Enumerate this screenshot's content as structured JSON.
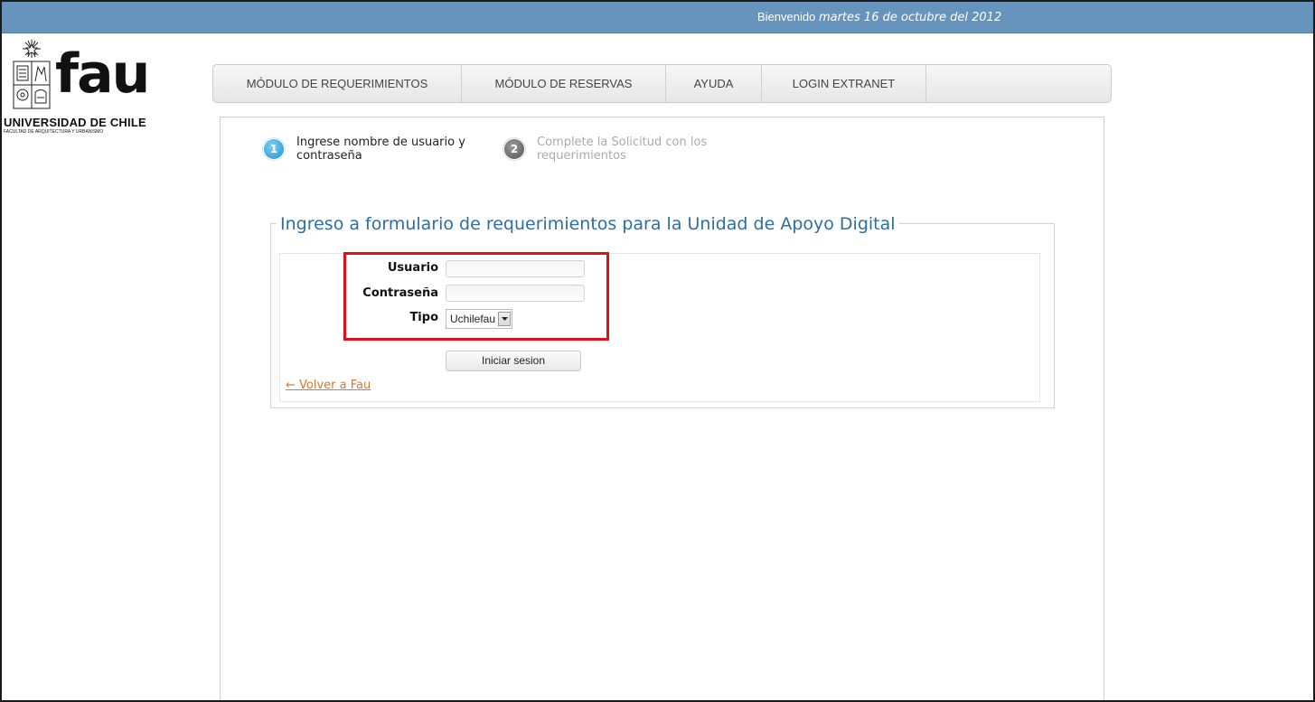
{
  "header": {
    "welcome_label": "Bienvenido",
    "date": "martes 16 de octubre del 2012"
  },
  "logo": {
    "brand": "fau",
    "university": "UNIVERSIDAD DE CHILE",
    "faculty": "FACULTAD DE ARQUITECTURA Y URBANISMO"
  },
  "nav": {
    "items": [
      {
        "label": "MÓDULO DE REQUERIMIENTOS"
      },
      {
        "label": "MÓDULO DE RESERVAS"
      },
      {
        "label": "AYUDA"
      },
      {
        "label": "LOGIN EXTRANET"
      }
    ]
  },
  "steps": [
    {
      "number": "1",
      "text": "Ingrese nombre de usuario y contraseña"
    },
    {
      "number": "2",
      "text": "Complete la Solicitud con los requerimientos"
    }
  ],
  "form": {
    "legend": "Ingreso a formulario de requerimientos para la Unidad de Apoyo Digital",
    "usuario_label": "Usuario",
    "usuario_value": "",
    "contrasena_label": "Contraseña",
    "contrasena_value": "",
    "tipo_label": "Tipo",
    "tipo_selected": "Uchilefau",
    "submit_label": "Iniciar sesion",
    "back_link": "← Volver a Fau"
  },
  "colors": {
    "topbar": "#6794bd",
    "legend_text": "#2d6ea3",
    "link": "#e07622",
    "highlight": "#e0101a",
    "step_active": "#1f8fd0",
    "step_inactive": "#555555"
  }
}
